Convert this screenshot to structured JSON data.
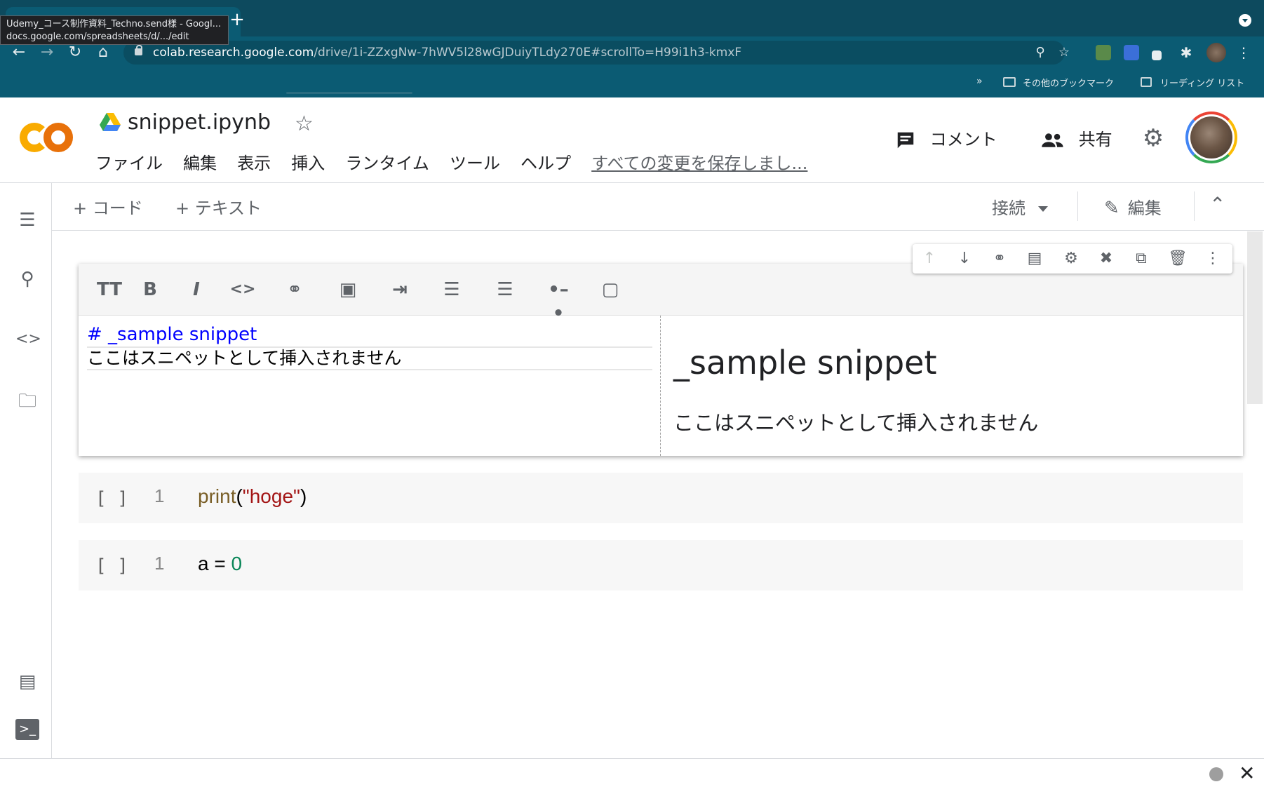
{
  "browser": {
    "tooltip": {
      "title": "Udemy_コース制作資料_Techno.send様 - Googl...",
      "url": "docs.google.com/spreadsheets/d/.../edit"
    },
    "address": {
      "host": "colab.research.google.com",
      "path": "/drive/1i-ZZxgNw-7hWV5l28wGJDuiyTLdy270E#scrollTo=H99i1h3-kmxF"
    },
    "bookmarks": {
      "overflow": "»",
      "other": "その他のブックマーク",
      "reading_list": "リーディング リスト"
    }
  },
  "header": {
    "notebook_title": "snippet.ipynb",
    "menu": [
      "ファイル",
      "編集",
      "表示",
      "挿入",
      "ランタイム",
      "ツール",
      "ヘルプ"
    ],
    "save_status": "すべての変更を保存しまし...",
    "comment_label": "コメント",
    "share_label": "共有"
  },
  "toolbar": {
    "add_code": "+ コード",
    "add_text": "+ テキスト",
    "connect": "接続",
    "edit": "編集"
  },
  "text_cell": {
    "source_line1": "# _sample snippet",
    "source_line2": "ここはスニペットとして挿入されません",
    "preview_heading": "_sample snippet",
    "preview_paragraph": "ここはスニペットとして挿入されません"
  },
  "code_cells": [
    {
      "run": "[ ]",
      "line_no": "1",
      "fn": "print",
      "open": "(",
      "str": "\"hoge\"",
      "close": ")"
    },
    {
      "run": "[ ]",
      "line_no": "1",
      "lhs": "a = ",
      "num": "0"
    }
  ],
  "colors": {
    "chrome_bg": "#0b5b73",
    "logo_orange": "#e8710a",
    "logo_yellow": "#f9ab00",
    "markdown_blue": "#0000ff",
    "string_red": "#a31515",
    "number_green": "#098658"
  }
}
